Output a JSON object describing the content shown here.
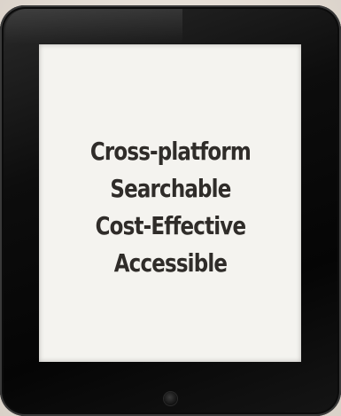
{
  "screen": {
    "lines": [
      "Cross-platform",
      "Searchable",
      "Cost-Effective",
      "Accessible"
    ]
  },
  "colors": {
    "text": "#2f2c29",
    "screen": "#f4f3ef",
    "bezel": "#0d0d0d"
  },
  "icons": {
    "home_button": "circle-home-button"
  }
}
